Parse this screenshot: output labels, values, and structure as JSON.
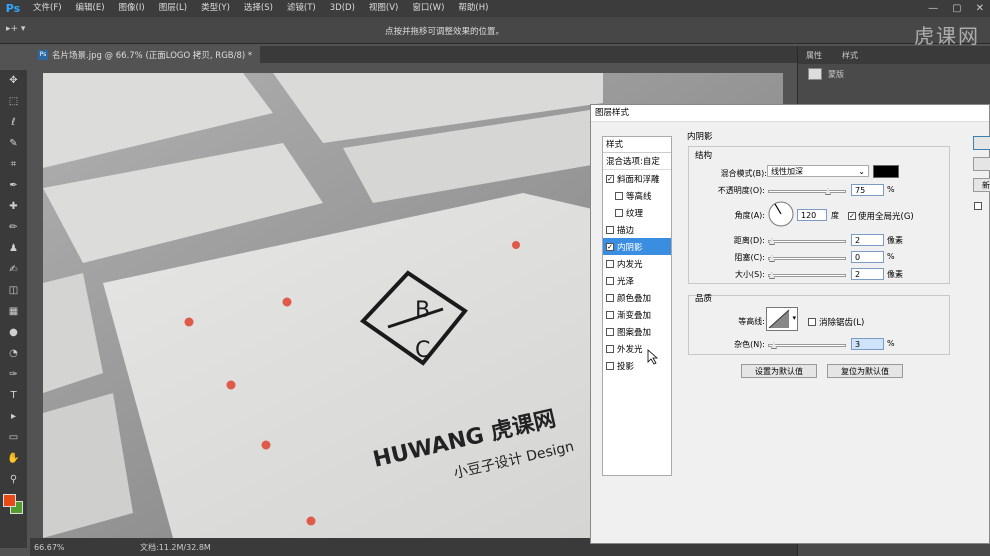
{
  "app": {
    "logo": "Ps"
  },
  "menubar": {
    "items": [
      "文件(F)",
      "编辑(E)",
      "图像(I)",
      "图层(L)",
      "类型(Y)",
      "选择(S)",
      "滤镜(T)",
      "3D(D)",
      "视图(V)",
      "窗口(W)",
      "帮助(H)"
    ]
  },
  "window_controls": [
    "—",
    "▢",
    "✕"
  ],
  "options_bar": {
    "tool": "▸+ ▾",
    "hint": "点按并拖移可调整效果的位置。"
  },
  "watermark": "虎课网",
  "document": {
    "tab_icon": "Ps",
    "tab_title": "名片场景.jpg @ 66.7% (正面LOGO 拷贝, RGB/8) *"
  },
  "toolbar": {
    "icons": [
      "move-icon",
      "marquee-icon",
      "lasso-icon",
      "quick-select-icon",
      "crop-icon",
      "eyedropper-icon",
      "healing-icon",
      "brush-icon",
      "stamp-icon",
      "history-brush-icon",
      "eraser-icon",
      "gradient-icon",
      "blur-icon",
      "dodge-icon",
      "pen-icon",
      "type-icon",
      "path-select-icon",
      "shape-icon",
      "hand-icon",
      "zoom-icon"
    ],
    "glyphs": [
      "✥",
      "⬚",
      "ℓ",
      "✎",
      "⌗",
      "✒",
      "✚",
      "✏",
      "♟",
      "✍",
      "◫",
      "▦",
      "●",
      "◔",
      "✑",
      "T",
      "▸",
      "▭",
      "✋",
      "⚲"
    ],
    "foreground_color": "#e84a16",
    "background_color": "#4f9e2f"
  },
  "status_bar": {
    "zoom": "66.67%",
    "doc_info": "文档:11.2M/32.8M"
  },
  "right_panel": {
    "tabs": [
      "属性",
      "样式"
    ],
    "row_label": "蒙版"
  },
  "canvas": {
    "logo_top": "B",
    "logo_bottom": "C",
    "brand": "HUWANG 虎课网",
    "tagline": "小豆子设计 Design"
  },
  "dialog": {
    "title": "图层样式",
    "styles_header": "样式",
    "blend_options": "混合选项:自定",
    "styles": [
      {
        "label": "斜面和浮雕",
        "checked": true,
        "sub": false,
        "selected": false
      },
      {
        "label": "等高线",
        "checked": false,
        "sub": true,
        "selected": false
      },
      {
        "label": "纹理",
        "checked": false,
        "sub": true,
        "selected": false
      },
      {
        "label": "描边",
        "checked": false,
        "sub": false,
        "selected": false
      },
      {
        "label": "内阴影",
        "checked": true,
        "sub": false,
        "selected": true
      },
      {
        "label": "内发光",
        "checked": false,
        "sub": false,
        "selected": false
      },
      {
        "label": "光泽",
        "checked": false,
        "sub": false,
        "selected": false
      },
      {
        "label": "颜色叠加",
        "checked": false,
        "sub": false,
        "selected": false
      },
      {
        "label": "渐变叠加",
        "checked": false,
        "sub": false,
        "selected": false
      },
      {
        "label": "图案叠加",
        "checked": false,
        "sub": false,
        "selected": false
      },
      {
        "label": "外发光",
        "checked": false,
        "sub": false,
        "selected": false
      },
      {
        "label": "投影",
        "checked": false,
        "sub": false,
        "selected": false
      }
    ],
    "section_title": "内阴影",
    "structure": {
      "title": "结构",
      "blend_mode_label": "混合模式(B):",
      "blend_mode": "线性加深",
      "blend_color": "#000000",
      "opacity_label": "不透明度(O):",
      "opacity": "75",
      "opacity_unit": "%",
      "angle_label": "角度(A):",
      "angle": "120",
      "angle_unit": "度",
      "global_light": "使用全局光(G)",
      "global_light_checked": true,
      "distance_label": "距离(D):",
      "distance": "2",
      "distance_unit": "像素",
      "choke_label": "阻塞(C):",
      "choke": "0",
      "choke_unit": "%",
      "size_label": "大小(S):",
      "size": "2",
      "size_unit": "像素"
    },
    "quality": {
      "title": "品质",
      "contour_label": "等高线:",
      "antialias": "消除锯齿(L)",
      "noise_label": "杂色(N):",
      "noise": "3",
      "noise_unit": "%"
    },
    "buttons": {
      "set_default": "设置为默认值",
      "reset_default": "复位为默认值",
      "side_partial": "新"
    }
  }
}
